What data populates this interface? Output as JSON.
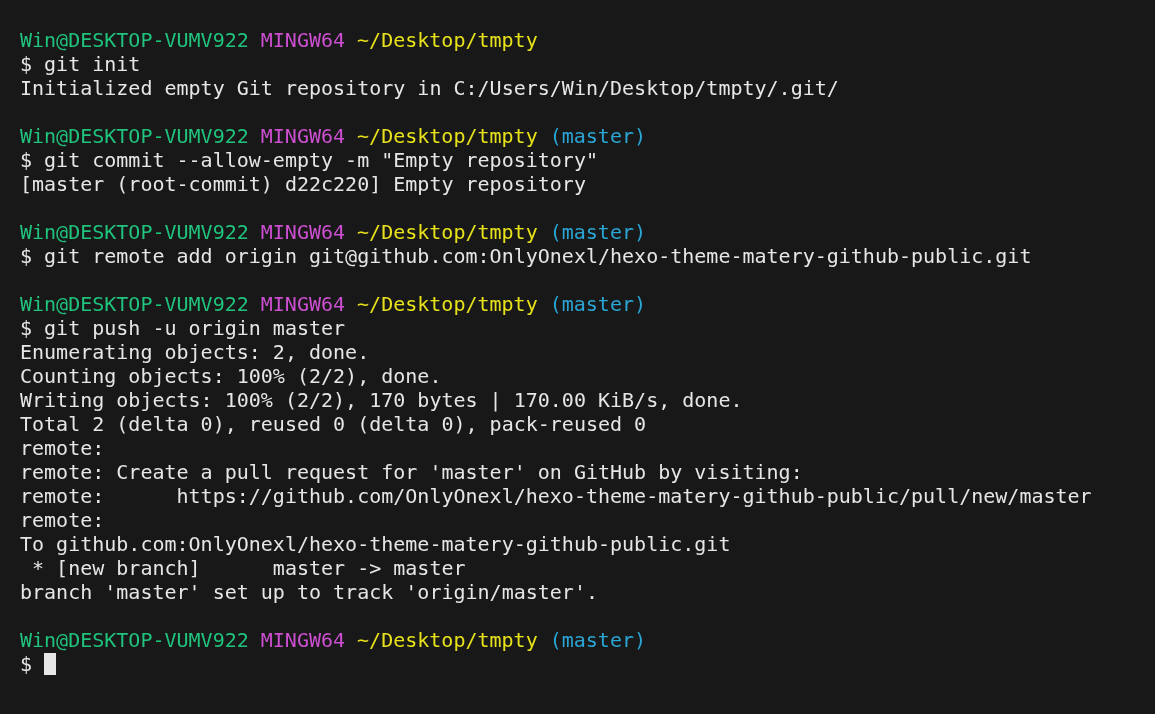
{
  "terminal": {
    "lines": [
      {
        "kind": "prompt",
        "user": "Win@DESKTOP-VUMV922",
        "system": "MINGW64",
        "path": "~/Desktop/tmpty"
      },
      {
        "kind": "text",
        "text": "$ git init"
      },
      {
        "kind": "text",
        "text": "Initialized empty Git repository in C:/Users/Win/Desktop/tmpty/.git/"
      },
      {
        "kind": "blank"
      },
      {
        "kind": "prompt",
        "user": "Win@DESKTOP-VUMV922",
        "system": "MINGW64",
        "path": "~/Desktop/tmpty",
        "branch": "(master)"
      },
      {
        "kind": "text",
        "text": "$ git commit --allow-empty -m \"Empty repository\""
      },
      {
        "kind": "text",
        "text": "[master (root-commit) d22c220] Empty repository"
      },
      {
        "kind": "blank"
      },
      {
        "kind": "prompt",
        "user": "Win@DESKTOP-VUMV922",
        "system": "MINGW64",
        "path": "~/Desktop/tmpty",
        "branch": "(master)"
      },
      {
        "kind": "text",
        "text": "$ git remote add origin git@github.com:OnlyOnexl/hexo-theme-matery-github-public.git"
      },
      {
        "kind": "blank"
      },
      {
        "kind": "prompt",
        "user": "Win@DESKTOP-VUMV922",
        "system": "MINGW64",
        "path": "~/Desktop/tmpty",
        "branch": "(master)"
      },
      {
        "kind": "text",
        "text": "$ git push -u origin master"
      },
      {
        "kind": "text",
        "text": "Enumerating objects: 2, done."
      },
      {
        "kind": "text",
        "text": "Counting objects: 100% (2/2), done."
      },
      {
        "kind": "text",
        "text": "Writing objects: 100% (2/2), 170 bytes | 170.00 KiB/s, done."
      },
      {
        "kind": "text",
        "text": "Total 2 (delta 0), reused 0 (delta 0), pack-reused 0"
      },
      {
        "kind": "text",
        "text": "remote:"
      },
      {
        "kind": "text",
        "text": "remote: Create a pull request for 'master' on GitHub by visiting:"
      },
      {
        "kind": "text",
        "text": "remote:      https://github.com/OnlyOnexl/hexo-theme-matery-github-public/pull/new/master"
      },
      {
        "kind": "text",
        "text": "remote:"
      },
      {
        "kind": "text",
        "text": "To github.com:OnlyOnexl/hexo-theme-matery-github-public.git"
      },
      {
        "kind": "text",
        "text": " * [new branch]      master -> master"
      },
      {
        "kind": "text",
        "text": "branch 'master' set up to track 'origin/master'."
      },
      {
        "kind": "blank"
      },
      {
        "kind": "prompt",
        "user": "Win@DESKTOP-VUMV922",
        "system": "MINGW64",
        "path": "~/Desktop/tmpty",
        "branch": "(master)"
      },
      {
        "kind": "input",
        "text": "$",
        "cursor": true
      }
    ]
  }
}
